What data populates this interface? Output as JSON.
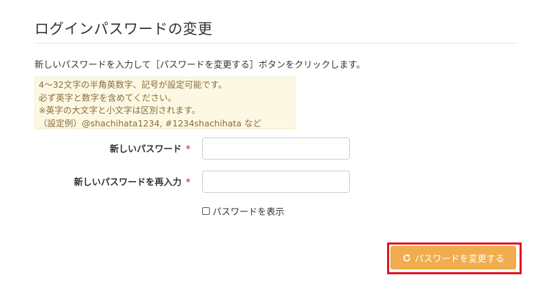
{
  "page": {
    "title": "ログインパスワードの変更",
    "instruction": "新しいパスワードを入力して［パスワードを変更する］ボタンをクリックします。"
  },
  "note": {
    "lines": [
      "4～32文字の半角英数字、記号が設定可能です。",
      "必ず英字と数字を含めてください。",
      "※英字の大文字と小文字は区別されます。",
      "（設定例）@shachihata1234, #1234shachihata など"
    ]
  },
  "form": {
    "new_password_label": "新しいパスワード",
    "confirm_password_label": "新しいパスワードを再入力",
    "required_mark": "*",
    "new_password_value": "",
    "confirm_password_value": "",
    "show_password_label": "パスワードを表示",
    "show_password_checked": false
  },
  "actions": {
    "submit_label": "パスワードを変更する",
    "submit_icon": "refresh-icon"
  },
  "colors": {
    "button": "#f0ad4e",
    "highlight_outline": "#e0101e",
    "note_background": "#fcf8e3",
    "required": "#d9534f"
  }
}
